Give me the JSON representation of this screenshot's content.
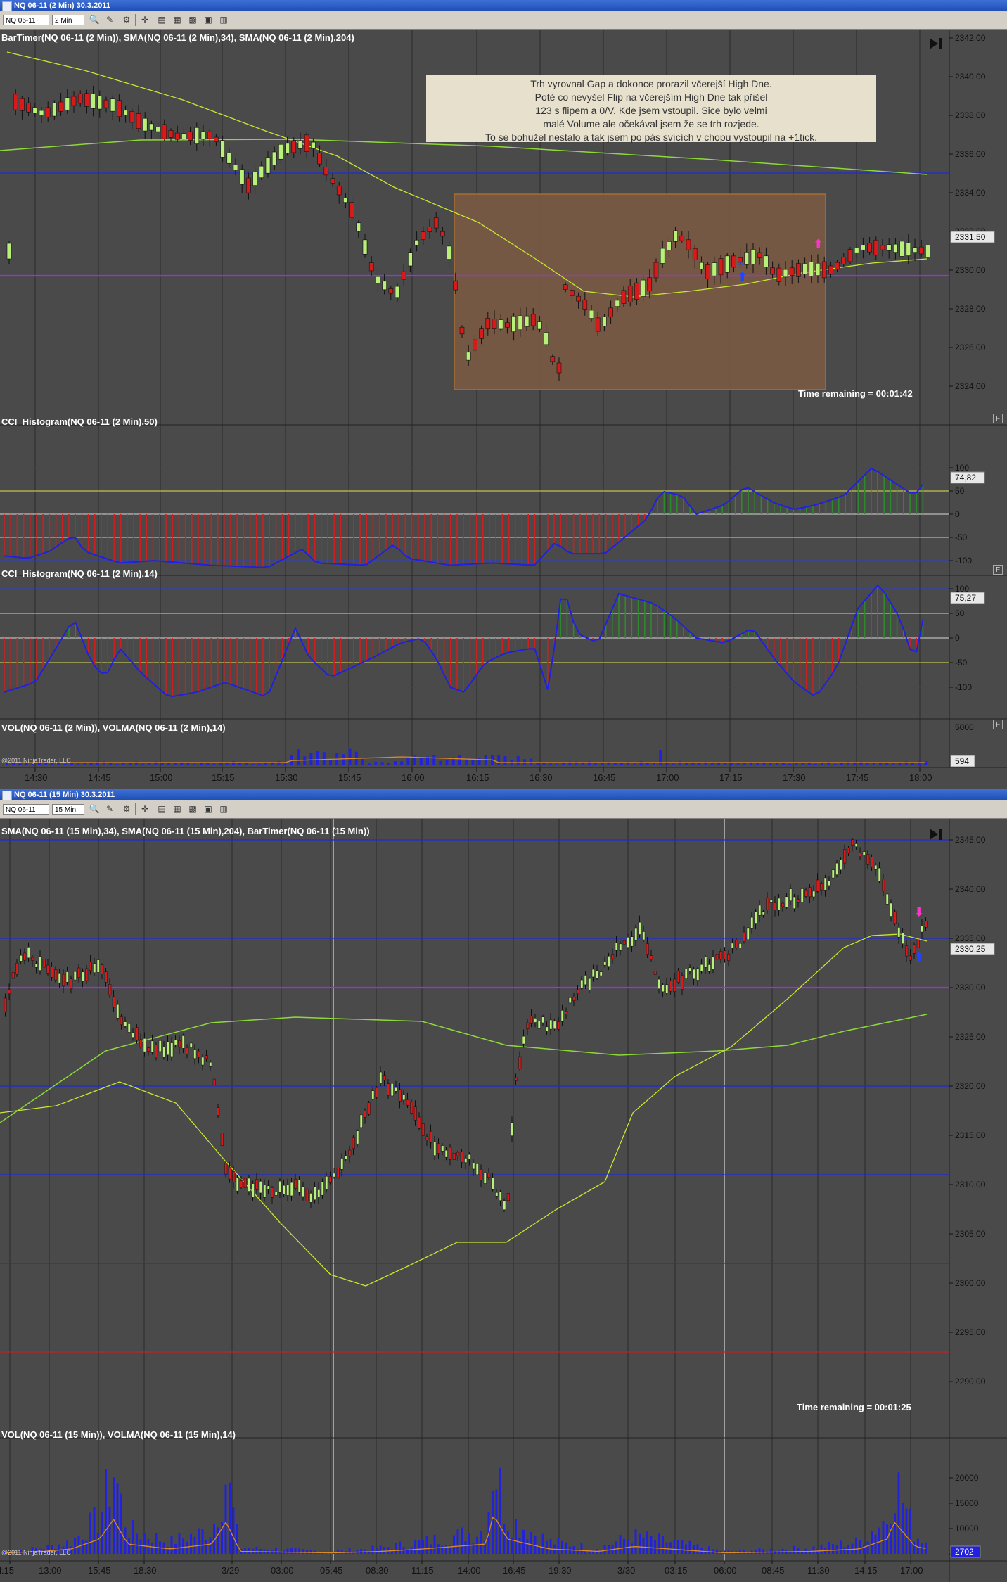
{
  "window1": {
    "title": "NQ 06-11 (2 Min)  30.3.2011",
    "toolbar": {
      "instrument": "NQ 06-11",
      "interval": "2 Min"
    },
    "price_panel_label": "BarTimer(NQ 06-11 (2 Min)), SMA(NQ 06-11 (2 Min),34), SMA(NQ 06-11 (2 Min),204)",
    "note_lines": [
      "Trh vyrovnal Gap a dokonce prorazil včerejší High Dne.",
      "Poté co nevyšel Flip na včerejším High Dne tak přišel",
      "123 s flipem a 0/V. Kde jsem vstoupil. Sice bylo velmi",
      "malé Volume ale očekával jsem že se trh rozjede.",
      "To se bohužel nestalo a tak jsem po pás svících v chopu vystoupil na +1tick."
    ],
    "time_remaining": "Time remaining = 00:01:42",
    "price_axis": [
      "2342,00",
      "2340,00",
      "2338,00",
      "2336,00",
      "2334,00",
      "2332,00",
      "2330,00",
      "2328,00",
      "2326,00",
      "2324,00"
    ],
    "price_last": "2331,50",
    "cci50_label": "CCI_Histogram(NQ 06-11 (2 Min),50)",
    "cci50_axis": [
      "100",
      "50",
      "0",
      "-50",
      "-100"
    ],
    "cci50_last": "74,82",
    "cci14_label": "CCI_Histogram(NQ 06-11 (2 Min),14)",
    "cci14_axis": [
      "100",
      "50",
      "0",
      "-50",
      "-100"
    ],
    "cci14_last": "75,27",
    "vol_label": "VOL(NQ 06-11 (2 Min)), VOLMA(NQ 06-11 (2 Min),14)",
    "vol_axis_top": "5000",
    "vol_last": "594",
    "copyright": "@2011 NinjaTrader, LLC",
    "time_axis": [
      "14:30",
      "14:45",
      "15:00",
      "15:15",
      "15:30",
      "15:45",
      "16:00",
      "16:15",
      "16:30",
      "16:45",
      "17:00",
      "17:15",
      "17:30",
      "17:45",
      "18:00"
    ],
    "f_label": "F"
  },
  "window2": {
    "title": "NQ 06-11 (15 Min)  30.3.2011",
    "toolbar": {
      "instrument": "NQ 06-11",
      "interval": "15 Min"
    },
    "price_panel_label": "SMA(NQ 06-11 (15 Min),34), SMA(NQ 06-11 (15 Min),204), BarTimer(NQ 06-11 (15 Min))",
    "time_remaining": "Time remaining = 00:01:25",
    "price_axis": [
      "2345,00",
      "2340,00",
      "2335,00",
      "2330,00",
      "2325,00",
      "2320,00",
      "2315,00",
      "2310,00",
      "2305,00",
      "2300,00",
      "2295,00",
      "2290,00"
    ],
    "price_last": "2330,25",
    "vol_label": "VOL(NQ 06-11 (15 Min)), VOLMA(NQ 06-11 (15 Min),14)",
    "vol_axis": [
      "20000",
      "15000",
      "10000",
      "5000"
    ],
    "vol_last": "2702",
    "copyright": "@2011 NinjaTrader, LLC",
    "time_axis": [
      "l:15",
      "13:00",
      "15:45",
      "18:30",
      "3/29",
      "03:00",
      "05:45",
      "08:30",
      "11:15",
      "14:00",
      "16:45",
      "19:30",
      "3/30",
      "03:15",
      "06:00",
      "08:45",
      "11:30",
      "14:15",
      "17:00"
    ]
  },
  "colors": {
    "background": "#4a4a4a",
    "up_candle": "#b9f07a",
    "down_candle": "#d91a1a",
    "sma34": "#c8e632",
    "sma204": "#8ed83a",
    "hline_blue": "#1c2ad6",
    "hline_magenta": "#9b2ff0",
    "cci_line": "#2020e0",
    "cci_neg_bar": "#cc2020",
    "cci_pos_bar": "#2c8a2c",
    "volume_bar": "#2222dd",
    "volma": "#d98a2a",
    "note_box": "#e6e0cc",
    "zone_box": "#7a5a44"
  }
}
